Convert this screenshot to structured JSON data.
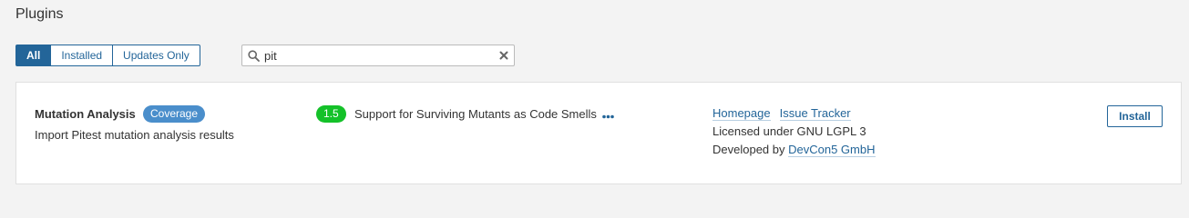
{
  "page": {
    "title": "Plugins"
  },
  "filters": {
    "options": [
      "All",
      "Installed",
      "Updates Only"
    ],
    "selected": "All"
  },
  "search": {
    "value": "pit",
    "placeholder": ""
  },
  "plugin": {
    "name": "Mutation Analysis",
    "category": "Coverage",
    "description": "Import Pitest mutation analysis results",
    "version": "1.5",
    "release_note": "Support for Surviving Mutants as Code Smells",
    "homepage_label": "Homepage",
    "issue_tracker_label": "Issue Tracker",
    "license": "Licensed under GNU LGPL 3",
    "developed_by_prefix": "Developed by",
    "developer": "DevCon5 GmbH",
    "install_label": "Install"
  },
  "colors": {
    "primary": "#236599",
    "category_badge": "#4a8ecb",
    "version_badge": "#14c129"
  },
  "icons": {
    "search": "search-icon",
    "clear": "close-icon",
    "more": "more-dots-icon"
  }
}
